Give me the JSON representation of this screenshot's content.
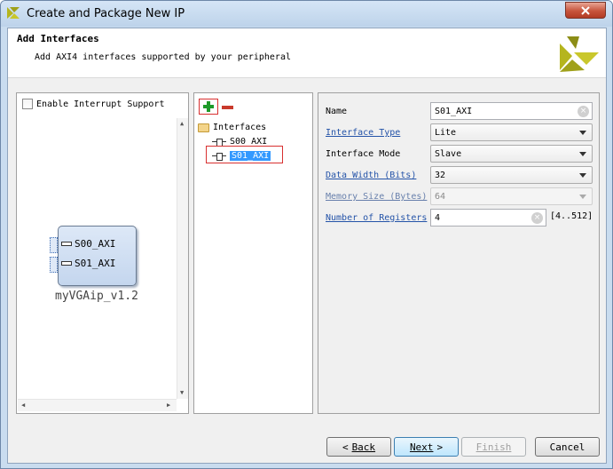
{
  "window": {
    "title": "Create and Package New IP",
    "close_icon": "close-icon"
  },
  "header": {
    "title": "Add Interfaces",
    "subtitle": "Add AXI4 interfaces supported by your peripheral"
  },
  "block_panel": {
    "checkbox_label": "Enable Interrupt Support",
    "checked": false,
    "ip_block": {
      "ports": [
        "S00_AXI",
        "S01_AXI"
      ],
      "name": "myVGAip_v1.2"
    }
  },
  "tree": {
    "root": "Interfaces",
    "items": [
      "S00_AXI",
      "S01_AXI"
    ],
    "selected": "S01_AXI"
  },
  "properties": {
    "name_label": "Name",
    "name_value": "S01_AXI",
    "interface_type_label": "Interface Type",
    "interface_type_value": "Lite",
    "interface_mode_label": "Interface Mode",
    "interface_mode_value": "Slave",
    "data_width_label": "Data Width (Bits)",
    "data_width_value": "32",
    "memory_size_label": "Memory Size (Bytes)",
    "memory_size_value": "64",
    "num_registers_label": "Number of Registers",
    "num_registers_value": "4",
    "num_registers_range": "[4..512]"
  },
  "buttons": {
    "back": "Back",
    "next": "Next",
    "finish": "Finish",
    "cancel": "Cancel"
  },
  "colors": {
    "accent": "#3399ff",
    "link": "#2453a8",
    "logo": "#b5b51e"
  }
}
